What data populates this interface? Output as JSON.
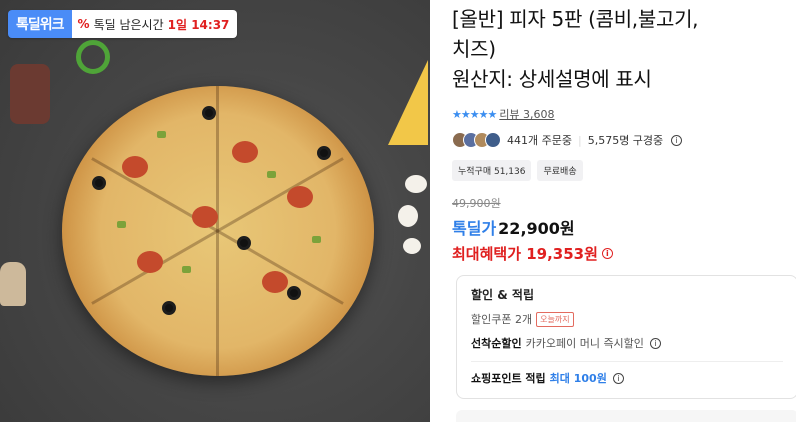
{
  "badge": {
    "logo": "톡딜위크",
    "timer_label": "톡딜 남은시간",
    "timer_value": "1일 14:37",
    "icon": "percent-icon"
  },
  "product": {
    "title_line1": "[올반] 피자 5판 (콤비,불고기,",
    "title_line2": "치즈)",
    "title_line3": "원산지: 상세설명에 표시"
  },
  "reviews": {
    "stars": "★★★★★",
    "label": "리뷰 3,608"
  },
  "buyers": {
    "orders": "441개 주문중",
    "watching": "5,575명 구경중"
  },
  "tags": [
    "누적구매 51,136",
    "무료배송"
  ],
  "price": {
    "original": "49,900원",
    "deal_label": "톡딜가",
    "deal_value": "22,900원",
    "max_benefit": "최대혜택가 19,353원"
  },
  "discount": {
    "title": "할인 & 적립",
    "coupon_text": "할인쿠폰 2개",
    "coupon_chip": "오늘까지",
    "first_come_label": "선착순할인",
    "first_come_text": "카카오페이 머니 즉시할인",
    "point_label": "쇼핑포인트 적립",
    "point_value": "최대 100원"
  },
  "colors": {
    "accent_blue": "#2f7fe8",
    "accent_red": "#e02020",
    "badge_blue": "#4a8cf7"
  }
}
